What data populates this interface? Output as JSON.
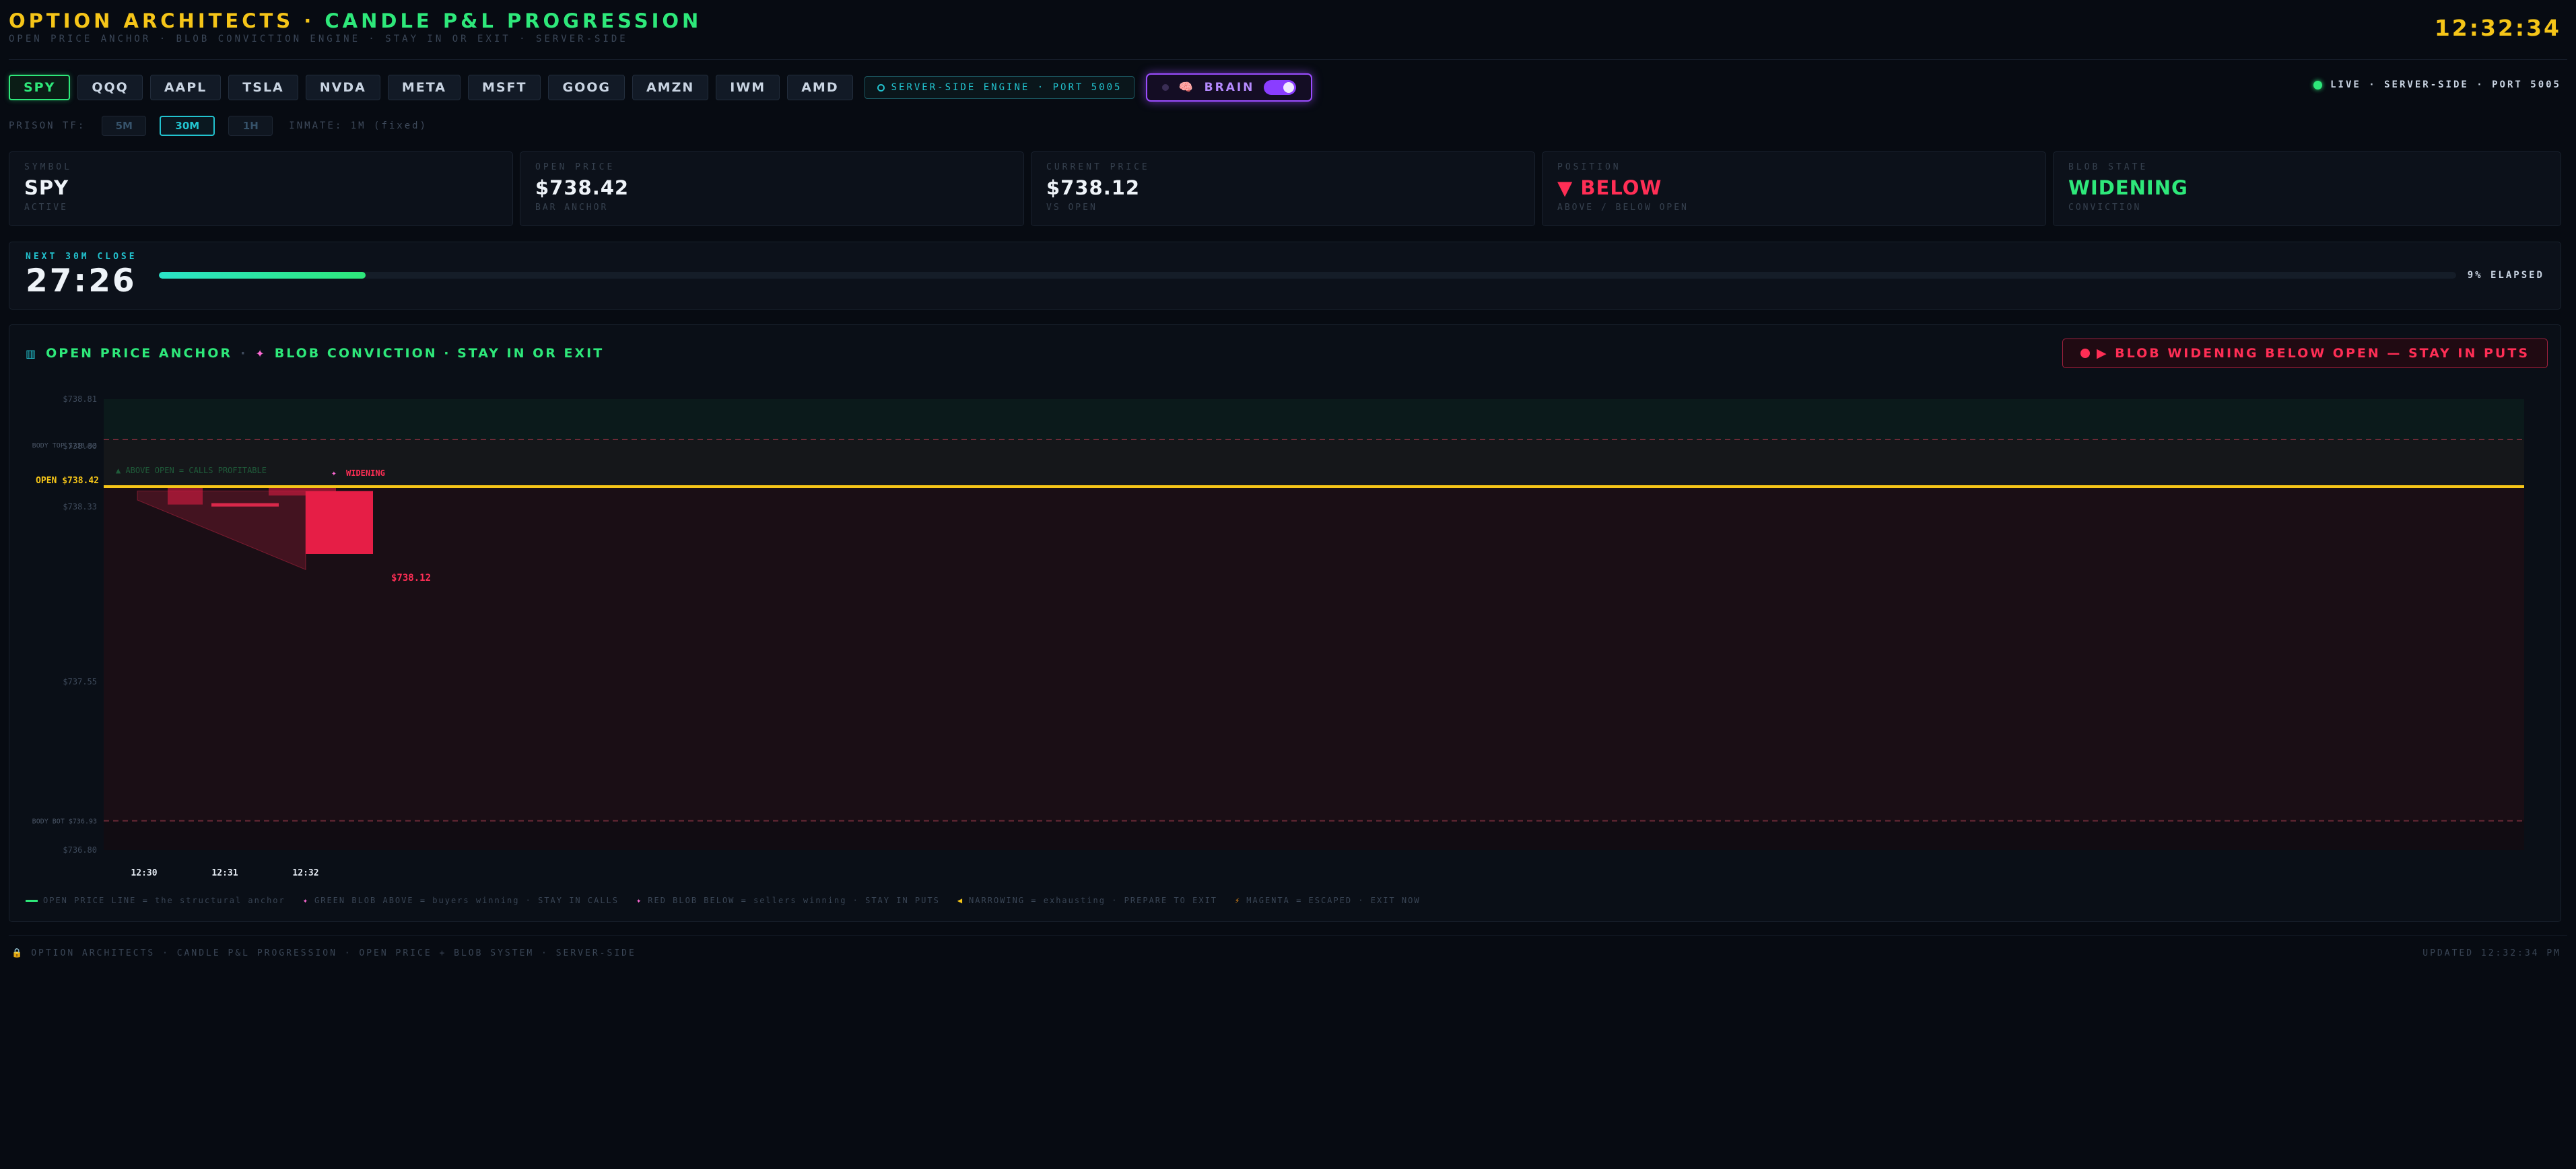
{
  "header": {
    "title_part1": "OPTION ARCHITECTS · ",
    "title_part2": "CANDLE P&L PROGRESSION",
    "subtitle": "OPEN PRICE ANCHOR · BLOB CONVICTION ENGINE · STAY IN OR EXIT · SERVER-SIDE",
    "clock": "12:32:34"
  },
  "tickers": [
    "SPY",
    "QQQ",
    "AAPL",
    "TSLA",
    "NVDA",
    "META",
    "MSFT",
    "GOOG",
    "AMZN",
    "IWM",
    "AMD"
  ],
  "active_ticker": "SPY",
  "engine_badge": "SERVER-SIDE ENGINE · PORT 5005",
  "brain": {
    "label": "BRAIN",
    "icon": "brain-icon",
    "enabled": true
  },
  "live_indicator": "LIVE · SERVER-SIDE · PORT 5005",
  "timeframe": {
    "label": "PRISON TF:",
    "options": [
      "5M",
      "30M",
      "1H"
    ],
    "active": "30M",
    "note": "INMATE: 1M (fixed)"
  },
  "cards": [
    {
      "label": "SYMBOL",
      "value": "SPY",
      "sub": "ACTIVE"
    },
    {
      "label": "OPEN PRICE",
      "value": "$738.42",
      "sub": "BAR ANCHOR"
    },
    {
      "label": "CURRENT PRICE",
      "value": "$738.12",
      "sub": "VS OPEN"
    },
    {
      "label": "POSITION",
      "value": "▼ BELOW",
      "sub": "ABOVE / BELOW OPEN"
    },
    {
      "label": "BLOB STATE",
      "value": "WIDENING",
      "sub": "CONVICTION"
    }
  ],
  "countdown": {
    "label": "NEXT 30M CLOSE",
    "value": "27:26",
    "elapsed_pct": 9,
    "elapsed_text": "9% ELAPSED"
  },
  "chart": {
    "heading_part1": "OPEN PRICE ANCHOR",
    "heading_sep": "·",
    "heading_part2": "BLOB CONVICTION · STAY IN OR EXIT",
    "alert": "▶ BLOB WIDENING BELOW OPEN — STAY IN PUTS",
    "legend": [
      {
        "text": "OPEN PRICE LINE = the structural anchor",
        "icon": "green-line-swatch"
      },
      {
        "text": "GREEN BLOB ABOVE = buyers winning · STAY IN CALLS",
        "icon": "blob-icon"
      },
      {
        "text": "RED BLOB BELOW = sellers winning · STAY IN PUTS",
        "icon": "blob-icon"
      },
      {
        "text": "NARROWING = exhausting · PREPARE TO EXIT",
        "icon": "triangle-left-icon"
      },
      {
        "text": "MAGENTA = ESCAPED · EXIT NOW",
        "icon": "lightning-icon"
      }
    ]
  },
  "chart_data": {
    "type": "candlestick",
    "y_ticks": [
      "$738.81",
      "$738.60",
      "$738.33",
      "$737.55",
      "$736.80"
    ],
    "y_tick_values": [
      738.81,
      738.6,
      738.33,
      737.55,
      736.8
    ],
    "ylim": [
      736.8,
      738.81
    ],
    "x_ticks": [
      "12:30",
      "12:31",
      "12:32"
    ],
    "open_line": {
      "label": "OPEN $738.42",
      "value": 738.42
    },
    "body_top": {
      "label": "BODY TOP $738.63",
      "value": 738.63
    },
    "body_bottom": {
      "label": "BODY BOT $736.93",
      "value": 736.93
    },
    "above_label": "▲ ABOVE OPEN = CALLS PROFITABLE",
    "state_label": "WIDENING",
    "price_label": "$738.12",
    "candles": [
      {
        "open": 738.42,
        "close": 738.34
      },
      {
        "open": 738.42,
        "close": 738.38
      },
      {
        "open": 738.4,
        "close": 738.12
      }
    ]
  },
  "footer": {
    "left": "OPTION ARCHITECTS · CANDLE P&L PROGRESSION · OPEN PRICE + BLOB SYSTEM · SERVER-SIDE",
    "right": "UPDATED 12:32:34 PM"
  }
}
